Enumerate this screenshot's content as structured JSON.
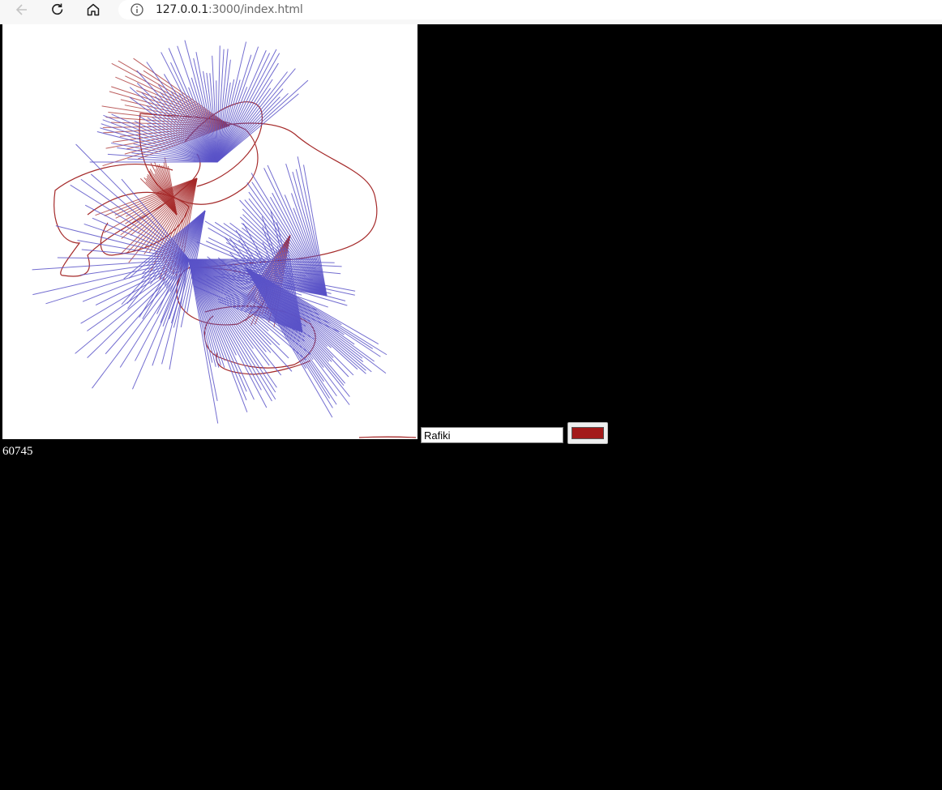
{
  "browser": {
    "url_host": "127.0.0.1",
    "url_path": ":3000/index.html",
    "icons": {
      "back": "back-arrow-icon",
      "reload": "reload-icon",
      "home": "home-icon",
      "info": "info-icon"
    }
  },
  "app": {
    "name_value": "Rafiki",
    "brush_color": "#a31a1a",
    "counter": "60745",
    "colors": {
      "red_stroke": "#a52a2a",
      "blue_stroke": "#5a54c8",
      "canvas_bg": "#ffffff",
      "page_bg": "#000000"
    }
  }
}
